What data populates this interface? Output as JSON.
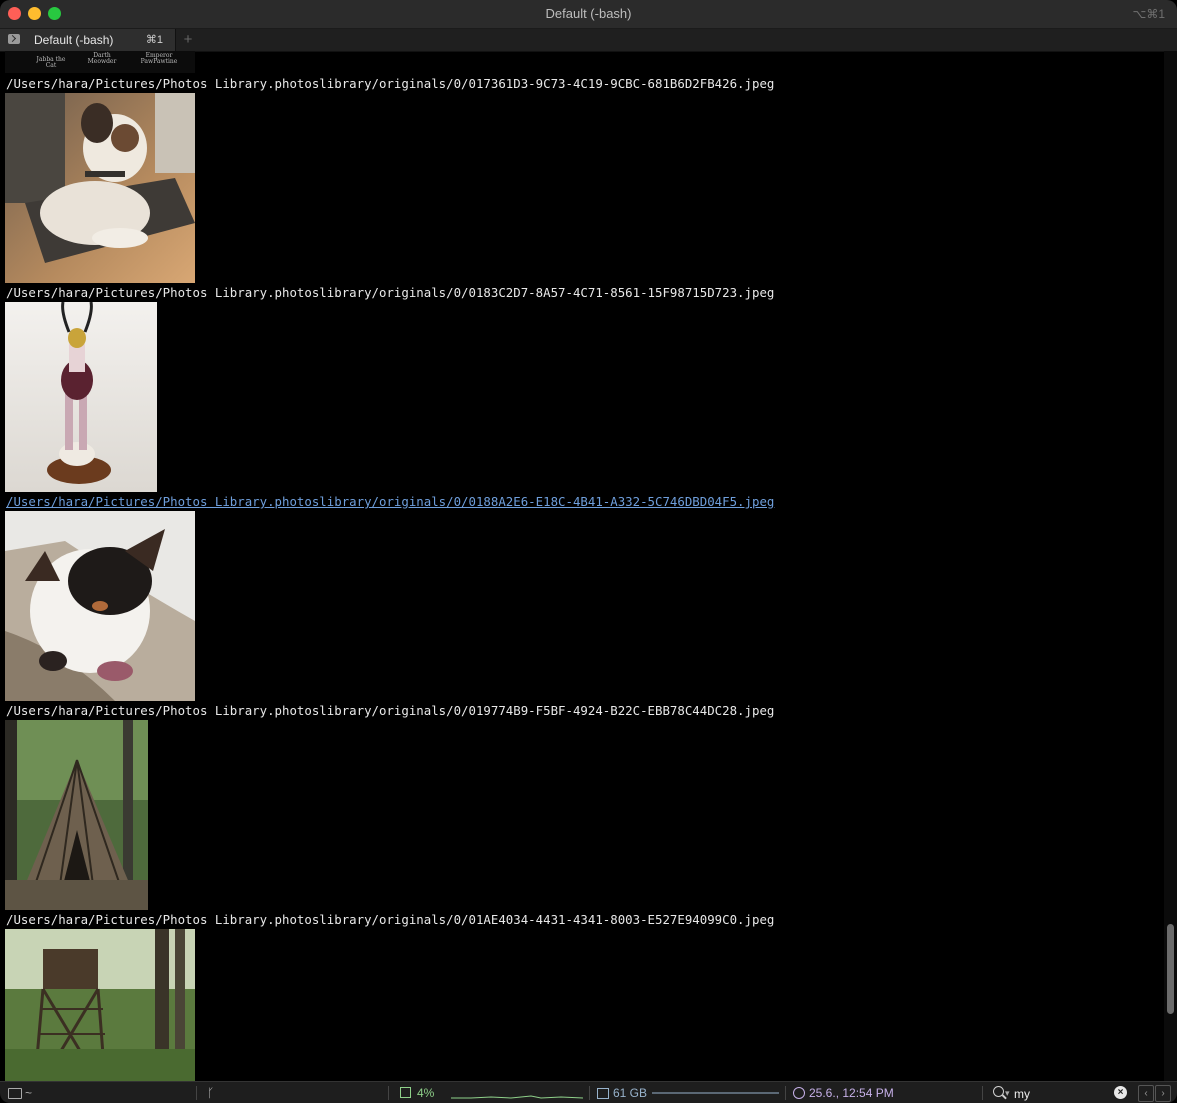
{
  "window": {
    "title": "Default (-bash)",
    "shortcut": "⌥⌘1"
  },
  "tab": {
    "label": "Default (-bash)",
    "shortcut": "⌘1",
    "new_tab": "+"
  },
  "top_strip": {
    "labels": [
      "Jabba the Cat",
      "Darth Meowder",
      "Emperor PawPawtine"
    ]
  },
  "entries": [
    {
      "path": "/Users/hara/Pictures/Photos Library.photoslibrary/originals/0/017361D3-9C73-4C19-9CBC-681B6D2FB426.jpeg",
      "is_link": false
    },
    {
      "path": "/Users/hara/Pictures/Photos Library.photoslibrary/originals/0/0183C2D7-8A57-4C71-8561-15F98715D723.jpeg",
      "is_link": false
    },
    {
      "path": "/Users/hara/Pictures/Photos Library.photoslibrary/originals/0/0188A2E6-E18C-4B41-A332-5C746DBD04F5.jpeg",
      "is_link": true
    },
    {
      "path": "/Users/hara/Pictures/Photos Library.photoslibrary/originals/0/019774B9-F5BF-4924-B22C-EBB78C44DC28.jpeg",
      "is_link": false
    },
    {
      "path": "/Users/hara/Pictures/Photos Library.photoslibrary/originals/0/01AE4034-4431-4341-8003-E527E94099C0.jpeg",
      "is_link": false
    }
  ],
  "statusbar": {
    "cwd": "~",
    "git_icon": "git-branch-icon",
    "cpu": "4%",
    "memory": "61 GB",
    "datetime": "25.6., 12:54 PM",
    "search_value": "my",
    "colors": {
      "cpu": "#8fd18a",
      "memory": "#98b3cc",
      "clock": "#c6b0e8"
    }
  }
}
